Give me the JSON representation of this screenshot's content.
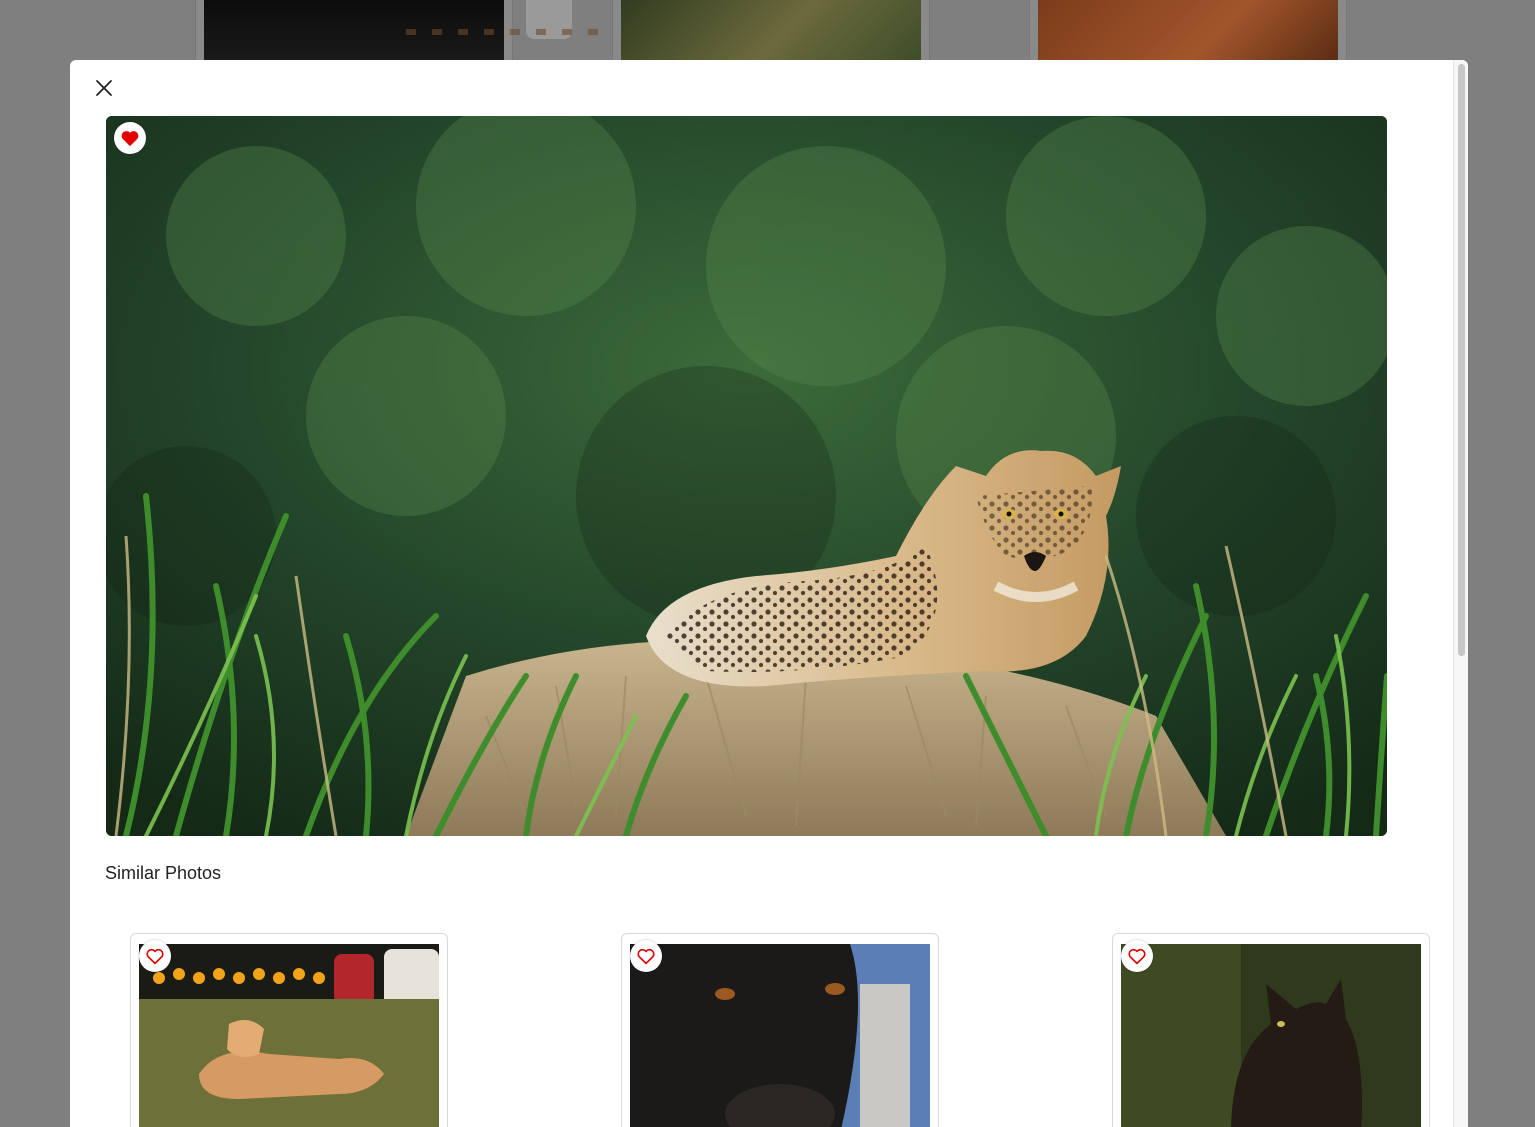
{
  "background_gallery": {
    "cards": [
      "street-night-photo",
      "jaguar-photo",
      "market-photo"
    ]
  },
  "modal": {
    "close_icon": "close-icon",
    "main_photo": {
      "subject": "jaguar",
      "favorite_state": "liked",
      "heart_color": "#e00000"
    },
    "similar_section": {
      "title": "Similar Photos",
      "cards": [
        {
          "subject": "dog-lying-on-grass",
          "favorite_state": "not-liked"
        },
        {
          "subject": "black-dog-closeup",
          "favorite_state": "not-liked"
        },
        {
          "subject": "black-cat",
          "favorite_state": "not-liked"
        }
      ]
    }
  },
  "colors": {
    "overlay": "#7f7f7f",
    "heart_red": "#e00000",
    "modal_bg": "#ffffff"
  }
}
